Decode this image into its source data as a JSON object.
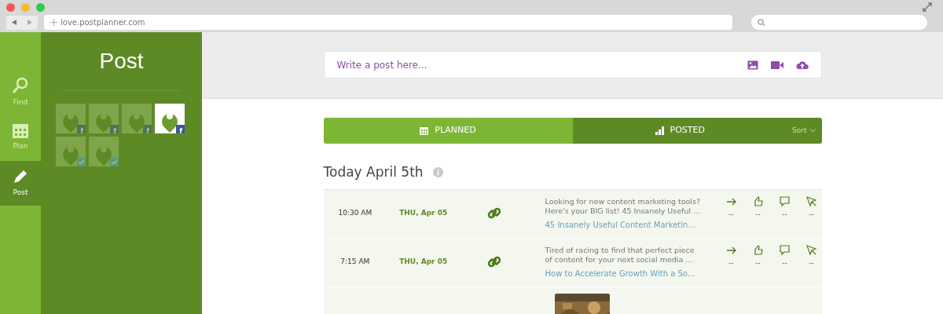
{
  "browser": {
    "url": "love.postplanner.com"
  },
  "nav": [
    {
      "label": "Find",
      "selected": false
    },
    {
      "label": "Plan",
      "selected": false
    },
    {
      "label": "Post",
      "selected": true
    }
  ],
  "panel": {
    "title": "Post",
    "accounts": [
      {
        "kind": "facebook",
        "selected": false
      },
      {
        "kind": "facebook",
        "selected": false
      },
      {
        "kind": "facebook",
        "selected": false
      },
      {
        "kind": "facebook",
        "selected": true
      },
      {
        "kind": "twitter",
        "selected": false
      },
      {
        "kind": "twitter",
        "selected": false
      }
    ]
  },
  "composer": {
    "placeholder": "Write a post here..."
  },
  "tabs": [
    {
      "label": "PLANNED",
      "selected": true
    },
    {
      "label": "POSTED",
      "selected": false
    }
  ],
  "sort": "Sort",
  "day": {
    "title": "Today April 5th"
  },
  "posts": [
    {
      "kind": "link",
      "time": "10:30 AM",
      "date": "THU, Apr 05",
      "text": "Looking for new content marketing tools? Here's your BIG list! 45 Insanely Useful ...",
      "link": "45 Insanely Useful Content Marketin...",
      "stats": [
        "--",
        "--",
        "--",
        "--"
      ]
    },
    {
      "kind": "link",
      "time": "7:15 AM",
      "date": "THU, Apr 05",
      "text": "Tired of racing to find that perfect piece of content for your next social media ...",
      "link": "How to Accelerate Growth With a So...",
      "stats": [
        "--",
        "--",
        "--",
        "--"
      ]
    },
    {
      "kind": "picture"
    }
  ]
}
